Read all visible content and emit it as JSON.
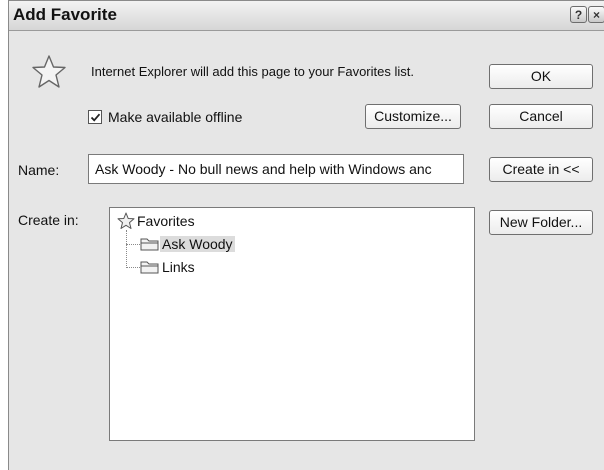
{
  "window": {
    "title": "Add Favorite",
    "help_button": "?",
    "close_button": "×"
  },
  "message": "Internet Explorer will add this page to your Favorites list.",
  "offline": {
    "label": "Make available offline",
    "checked": true
  },
  "buttons": {
    "customize": "Customize...",
    "ok": "OK",
    "cancel": "Cancel",
    "create_in": "Create in <<",
    "new_folder": "New Folder..."
  },
  "name_field": {
    "label": "Name:",
    "value": "Ask Woody - No bull news and help with Windows anc"
  },
  "create_in": {
    "label": "Create in:",
    "root": "Favorites",
    "folders": [
      {
        "label": "Ask Woody",
        "selected": true
      },
      {
        "label": "Links",
        "selected": false
      }
    ]
  }
}
